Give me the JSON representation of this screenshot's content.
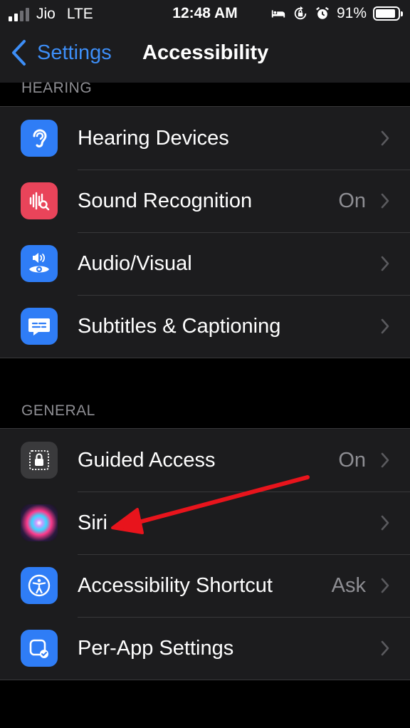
{
  "status_bar": {
    "carrier": "Jio",
    "network": "LTE",
    "time": "12:48 AM",
    "battery_percent_label": "91%",
    "battery_level": 0.91,
    "icons": [
      "bed-icon",
      "orientation-lock-icon",
      "alarm-icon"
    ]
  },
  "nav": {
    "back_label": "Settings",
    "title": "Accessibility"
  },
  "sections": {
    "hearing": {
      "header": "HEARING",
      "rows": [
        {
          "label": "Hearing Devices",
          "value": "",
          "icon": "ear-icon",
          "icon_color": "#2f7df6"
        },
        {
          "label": "Sound Recognition",
          "value": "On",
          "icon": "waveform-search-icon",
          "icon_color": "#e9445a"
        },
        {
          "label": "Audio/Visual",
          "value": "",
          "icon": "speaker-eye-icon",
          "icon_color": "#2f7df6"
        },
        {
          "label": "Subtitles & Captioning",
          "value": "",
          "icon": "caption-bubble-icon",
          "icon_color": "#2f7df6"
        }
      ]
    },
    "general": {
      "header": "GENERAL",
      "rows": [
        {
          "label": "Guided Access",
          "value": "On",
          "icon": "lock-icon",
          "icon_color": "#3a3a3c"
        },
        {
          "label": "Siri",
          "value": "",
          "icon": "siri-icon",
          "icon_color": ""
        },
        {
          "label": "Accessibility Shortcut",
          "value": "Ask",
          "icon": "accessibility-icon",
          "icon_color": "#2f7df6"
        },
        {
          "label": "Per-App Settings",
          "value": "",
          "icon": "app-check-icon",
          "icon_color": "#2f7df6"
        }
      ]
    }
  },
  "colors": {
    "accent": "#3d8ef7",
    "annotation_arrow": "#e8141c"
  }
}
